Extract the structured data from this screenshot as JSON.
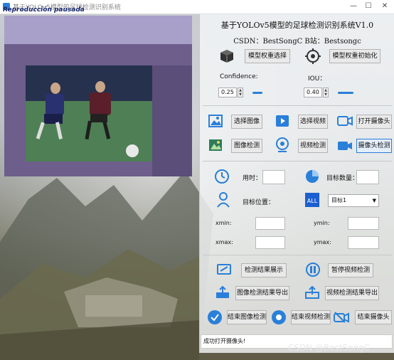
{
  "window": {
    "title": "基于YOLOv5模型的足球检测识别系统",
    "overlay_text": "Reproducción pausada",
    "minimize": "—",
    "maximize": "☐",
    "close": "✕"
  },
  "header": {
    "title": "基于YOLOv5模型的足球检测识别系统V1.0",
    "author_line": "CSDN：BestSongC   B站：Bestsongc"
  },
  "model": {
    "select_label": "模型权重选择",
    "init_label": "模型权重初始化"
  },
  "params": {
    "confidence_label": "Confidence:",
    "confidence_value": "0.25",
    "iou_label": "IOU：",
    "iou_value": "0.40"
  },
  "sources": {
    "select_image": "选择图像",
    "select_video": "选择视频",
    "open_camera": "打开摄像头",
    "image_detect": "图像检测",
    "video_detect": "视频检测",
    "camera_detect": "摄像头检测"
  },
  "stats": {
    "time_label": "用时：",
    "count_label": "目标数量：",
    "position_label": "目标位置：",
    "target_selected": "目标1",
    "xmin_label": "xmin:",
    "ymin_label": "ymin:",
    "xmax_label": "xmax:",
    "ymax_label": "ymax:"
  },
  "actions": {
    "show_result": "检测结果展示",
    "pause_video": "暂停视频检测",
    "export_image": "图像检测结果导出",
    "export_video": "视频检测结果导出",
    "stop_image": "结束图像检测",
    "stop_video": "结束视频检测",
    "stop_camera": "结束摄像头"
  },
  "status": {
    "message": "成功打开摄像头!"
  },
  "watermark": "CSDN @BestSongC",
  "colors": {
    "accent": "#2a7fd9",
    "panel_bg": "#f4f6f8",
    "video_frame_bg": "#6a5c86"
  }
}
